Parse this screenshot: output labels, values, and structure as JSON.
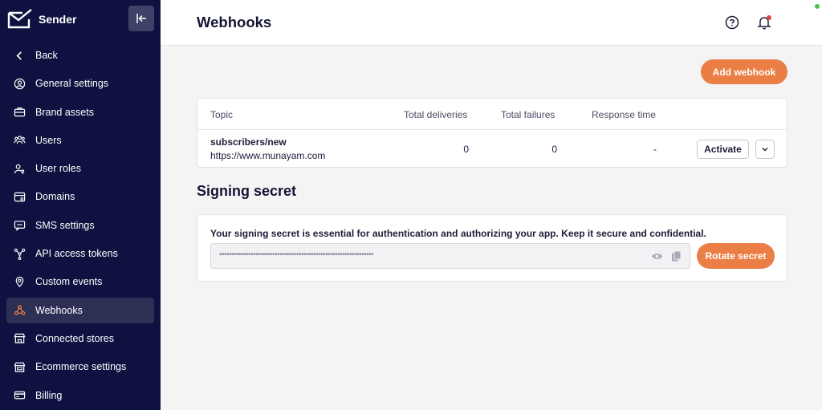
{
  "app": {
    "name": "Sender"
  },
  "sidebar": {
    "items": [
      {
        "label": "Back",
        "icon": "chevron-left-icon"
      },
      {
        "label": "General settings",
        "icon": "user-circle-icon"
      },
      {
        "label": "Brand assets",
        "icon": "briefcase-icon"
      },
      {
        "label": "Users",
        "icon": "users-icon"
      },
      {
        "label": "User roles",
        "icon": "user-key-icon"
      },
      {
        "label": "Domains",
        "icon": "browser-icon"
      },
      {
        "label": "SMS settings",
        "icon": "sms-icon"
      },
      {
        "label": "API access tokens",
        "icon": "network-icon"
      },
      {
        "label": "Custom events",
        "icon": "location-pin-icon"
      },
      {
        "label": "Webhooks",
        "icon": "webhook-icon",
        "active": true
      },
      {
        "label": "Connected stores",
        "icon": "store-icon"
      },
      {
        "label": "Ecommerce settings",
        "icon": "shop-icon"
      },
      {
        "label": "Billing",
        "icon": "card-icon"
      }
    ]
  },
  "header": {
    "title": "Webhooks"
  },
  "webhooks": {
    "add_label": "Add webhook",
    "columns": [
      "Topic",
      "Total deliveries",
      "Total failures",
      "Response time"
    ],
    "rows": [
      {
        "topic": "subscribers/new",
        "url": "https://www.munayam.com",
        "deliveries": "0",
        "failures": "0",
        "response_time": "-",
        "action_label": "Activate"
      }
    ]
  },
  "signing": {
    "title": "Signing secret",
    "description": "Your signing secret is essential for authentication and authorizing your app. Keep it secure and confidential.",
    "masked_value": "••••••••••••••••••••••••••••••••••••••••••••••••••••••••••••••••",
    "rotate_label": "Rotate secret"
  },
  "colors": {
    "sidebar_bg": "#0f1140",
    "accent": "#ea7e45",
    "active_icon": "#ea7e45"
  }
}
